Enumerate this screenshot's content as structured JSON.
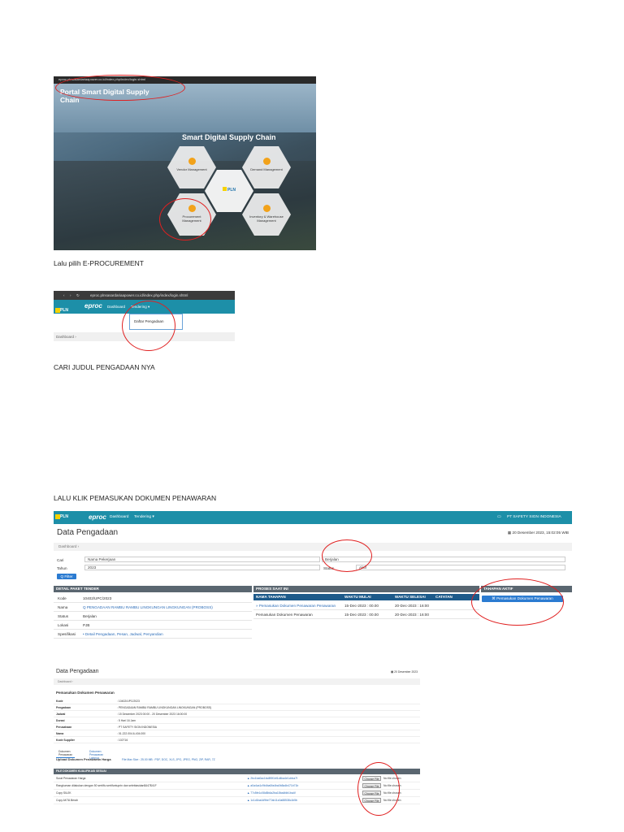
{
  "step_captions": {
    "step1": "Lalu pilih E-PROCUREMENT",
    "step2": "CARI JUDUL PENGADAAN NYA",
    "step3": "LALU KLIK PEMASUKAN DOKUMEN PENAWARAN"
  },
  "portal": {
    "url": "eproc.plnsasardariaapower.co.id/index.php/index/login.shtml",
    "title": "Portal Smart Digital Supply Chain",
    "heading": "Smart Digital Supply Chain",
    "tiles": {
      "vendor": "Vendor Management",
      "demand": "Demand Management",
      "center": "PLN",
      "procurement": "Procurement Management",
      "inventory": "Inventory & Warehouse Management"
    }
  },
  "eproc_menu": {
    "url": "eproc.plnsasardariaapower.co.id/index.php/index/login.shtml",
    "brand": "PLN",
    "logo": "eproc",
    "nav": {
      "dashboard": "Dashboard",
      "tendering": "Tendering ▾"
    },
    "dropdown_item": "Daftar Pengadaan",
    "breadcrumb": "Dashboard  ›"
  },
  "data_pengadaan": {
    "page_title": "Data Pengadaan",
    "date": "▦ 20 Desember 2023, 15:02:05 WIB",
    "user": "PT SAFETY SIGN INDONESIA",
    "breadcrumb": "Dashboard  ›",
    "filters": {
      "cari_label": "Cari",
      "cari_value": "Nama Pekerjaan",
      "status_value": "Berjalan",
      "tahun_label": "Tahun",
      "tahun_value": "2023",
      "status_label": "Status",
      "aktif_value": "Aktif",
      "filter_button": "Q Filter"
    },
    "detail_header": "DETAIL PAKET TENDER",
    "detail": [
      {
        "k": "Kode",
        "v": "10402/UPC/2023"
      },
      {
        "k": "Nama",
        "v": "Q PENGADAAN RAMBU RAMBU LINGKUNGAN LINGKUNGAN (PROBOSS)"
      },
      {
        "k": "Status",
        "v": "Berjalan"
      },
      {
        "k": "Lokasi",
        "v": "PJB"
      },
      {
        "k": "Spesifikasi",
        "v": "• Detail Pengadaan, Pesan, Jadwal, Penyandian"
      }
    ],
    "proses_header": "PROSES SAAT INI",
    "proses_cols": [
      "NAMA TAHAPAN",
      "WAKTU MULAI",
      "WAKTU SELESAI",
      "CATATAN"
    ],
    "proses_rows": [
      [
        "» Pemasukan Dokumen Penawaran Penawaran",
        "15-Dec-2023 : 00.00",
        "20-Dec-2023 : 16:00",
        ""
      ],
      [
        "Pemasukan Dokumen Penawaran",
        "15-Dec-2023 : 00.00",
        "20-Dec-2023 : 16:00",
        ""
      ]
    ],
    "aktif_header": "TAHAPAN AKTIF",
    "aktif_button": "⌘ Pemasukan Dokumen Penawaran"
  },
  "pemasukan": {
    "page_title": "Data Pengadaan",
    "date": "▦ 20 Desember 2023",
    "breadcrumb": "Dashboard  ›",
    "section": "Pemasukan Dokumen Penawaran",
    "info": [
      {
        "k": "Kode",
        "v": ": 10402/UPC/2023"
      },
      {
        "k": "Pengadaan",
        "v": ": PENGADAAN RAMBU RAMBU LINGKUNGAN LINGKUNGAN (PROBOSS)"
      },
      {
        "k": "Jadwal",
        "v": ": 15 Desember 2023 00:00 - 20 Desember 2023 16:00:00"
      },
      {
        "k": "Durasi",
        "v": ": 5 Hari 16 Jam"
      },
      {
        "k": "Perusahaan",
        "v": ": PT SAFETY SIGN INDONESIA"
      },
      {
        "k": "Nama",
        "v": ": 01.222.004.6-404.000"
      },
      {
        "k": "Kode Supplier",
        "v": ": 102716"
      }
    ],
    "tabs": [
      "Dokumen Penawaran",
      "Dokumen Penawaran Lainnya"
    ],
    "upload_title": "Upload Dokumen Penawaran Harga",
    "upload_note": "File Max Size : 25.00 MB : PDF, DOC, XLS, JPG, JPEG, PNG, ZIP, RAR, 7Z",
    "file_header": "FILE DOKUMEN KUALIFIKASI SESUAI",
    "files": [
      {
        "name": "Surat Penawaran Harga",
        "hash": "▲ 2bc1ba0ac1bc8f5f1bf1d4ba4e1cbba7f",
        "btn": "Choose File",
        "nofile": "No file chosen"
      },
      {
        "name": "Rangkuman dilakukan dengan 50 sertifiu sertifuntuprin dan selebiasidan$447$41F",
        "hash": "▲ a0a4ca1c9b4ba0fa4ba0b8a4b471b71b",
        "btn": "Choose File",
        "nofile": "No file chosen"
      },
      {
        "name": "Copy SIUJK",
        "hash": "▲ 77c5fe1c08d8b4a2ba18ba4fdb1ba4f",
        "btn": "Choose File",
        "nofile": "No file chosen"
      },
      {
        "name": "Copy AKTA Berah",
        "hash": "▲ 1c1d1ba4d9be77ab11c0a88538c1b5b",
        "btn": "Choose File",
        "nofile": "No file chosen"
      }
    ]
  }
}
